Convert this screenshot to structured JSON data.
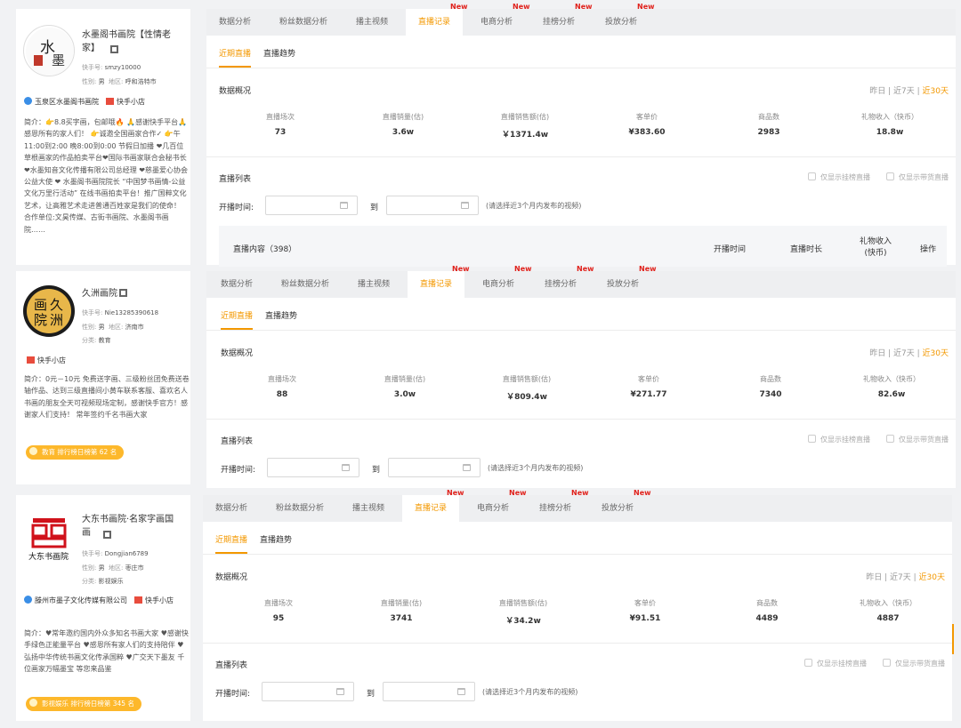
{
  "colors": {
    "accent": "#f39800",
    "new_badge": "#e0211b",
    "rank_badge": "#fdb82b"
  },
  "panels": [
    {
      "profile": {
        "name": "水墨阁书画院【性情老家】",
        "id_label": "快手号:",
        "id_value": "smzy10000",
        "gender_label": "性别:",
        "gender": "男",
        "region_label": "地区:",
        "region": "呼和浩特市",
        "category_label": "",
        "category": "",
        "verify": "玉泉区水墨阁书画院",
        "shop": "快手小店",
        "bio": "简介：👉8.8买字画，包邮哦🔥 🙏感谢快手平台🙏感恩所有的家人们！ 👉诚邀全国画家合作✓ 👉午11:00到2:00 晚8:00到0:00 节假日加播 ❤几百位草根画家的作品拍卖平台❤国际书画家联合会秘书长 ❤水墨知音文化传播有限公司总经理 ❤慈墨爱心协会公益大使 ❤ 水墨阁书画院院长 “中国梦书画情-公益文化万里行活动” 在线书画拍卖平台！推广国粹文化艺术，让高雅艺术走进普通百姓家是我们的使命！ 合作单位:文昊传媒、古街书画院、水墨阁书画院……",
        "rank": ""
      },
      "tabs": [
        "数据分析",
        "粉丝数据分析",
        "播主视频",
        "直播记录",
        "电商分析",
        "挂榜分析",
        "投放分析"
      ],
      "new_label": "New",
      "subtabs": [
        "近期直播",
        "直播趋势"
      ],
      "overview_title": "数据概况",
      "range": {
        "a": "昨日",
        "sep": "|",
        "b": "近7天",
        "c": "近30天"
      },
      "stats": [
        {
          "label": "直播场次",
          "value": "73"
        },
        {
          "label": "直播销量(估)",
          "value": "3.6w"
        },
        {
          "label": "直播销售额(估)",
          "value": "￥1371.4w"
        },
        {
          "label": "客单价",
          "value": "¥383.60"
        },
        {
          "label": "商品数",
          "value": "2983"
        },
        {
          "label": "礼物收入（快币）",
          "value": "18.8w"
        }
      ],
      "list_title": "直播列表",
      "check_a": "仅显示挂榜直播",
      "check_b": "仅显示带货直播",
      "time_label": "开播时间:",
      "to": "到",
      "hint": "(请选择近3个月内发布的视频)",
      "table": {
        "col1": "直播内容（398）",
        "col2": "开播时间",
        "col3": "直播时长",
        "col4a": "礼物收入",
        "col4b": "(快币)",
        "col5": "操作"
      }
    },
    {
      "profile": {
        "name": "久洲画院",
        "id_label": "快手号:",
        "id_value": "Nie13285390618",
        "gender_label": "性别:",
        "gender": "男",
        "region_label": "地区:",
        "region": "济南市",
        "category_label": "分类:",
        "category": "教育",
        "verify": "",
        "shop": "快手小店",
        "bio": "简介：0元－10元 免费送字画、三级粉丝团免费送卷轴作品、达到三级直播间小黄车联系客服、喜欢名人书画的朋友全天可视频现场定制，感谢快手官方！感谢家人们支持！ 常年签约千名书画大家",
        "rank": "教育 排行榜日榜第 62 名"
      },
      "tabs": [
        "数据分析",
        "粉丝数据分析",
        "播主视频",
        "直播记录",
        "电商分析",
        "挂榜分析",
        "投放分析"
      ],
      "new_label": "New",
      "subtabs": [
        "近期直播",
        "直播趋势"
      ],
      "overview_title": "数据概况",
      "range": {
        "a": "昨日",
        "sep": "|",
        "b": "近7天",
        "c": "近30天"
      },
      "stats": [
        {
          "label": "直播场次",
          "value": "88"
        },
        {
          "label": "直播销量(估)",
          "value": "3.0w"
        },
        {
          "label": "直播销售额(估)",
          "value": "￥809.4w"
        },
        {
          "label": "客单价",
          "value": "¥271.77"
        },
        {
          "label": "商品数",
          "value": "7340"
        },
        {
          "label": "礼物收入（快币）",
          "value": "82.6w"
        }
      ],
      "list_title": "直播列表",
      "check_a": "仅显示挂榜直播",
      "check_b": "仅显示带货直播",
      "time_label": "开播时间:",
      "to": "到",
      "hint": "(请选择近3个月内发布的视频)"
    },
    {
      "profile": {
        "name": "大东书画院·名家字画国画",
        "id_label": "快手号:",
        "id_value": "Dongjian6789",
        "gender_label": "性别:",
        "gender": "男",
        "region_label": "地区:",
        "region": "枣庄市",
        "category_label": "分类:",
        "category": "影视娱乐",
        "verify": "滕州市墨子文化传媒有限公司",
        "shop": "快手小店",
        "bio": "简介：♥常年邀约国内外众多知名书画大家 ♥感谢快手绿色正能量平台 ♥感恩所有家人们的支持陪伴 ♥弘扬中华传统书画文化传承国粹 ♥广交天下墨友 千位画家万幅墨宝 等您来品鉴",
        "rank": "影视娱乐 排行榜日榜第 345 名"
      },
      "tabs": [
        "数据分析",
        "粉丝数据分析",
        "播主视频",
        "直播记录",
        "电商分析",
        "挂榜分析",
        "投放分析"
      ],
      "new_label": "New",
      "subtabs": [
        "近期直播",
        "直播趋势"
      ],
      "overview_title": "数据概况",
      "range": {
        "a": "昨日",
        "sep": "|",
        "b": "近7天",
        "c": "近30天"
      },
      "stats": [
        {
          "label": "直播场次",
          "value": "95"
        },
        {
          "label": "直播销量(估)",
          "value": "3741"
        },
        {
          "label": "直播销售额(估)",
          "value": "￥34.2w"
        },
        {
          "label": "客单价",
          "value": "¥91.51"
        },
        {
          "label": "商品数",
          "value": "4489"
        },
        {
          "label": "礼物收入（快币）",
          "value": "4887"
        }
      ],
      "list_title": "直播列表",
      "check_a": "仅显示挂榜直播",
      "check_b": "仅显示带货直播",
      "time_label": "开播时间:",
      "to": "到",
      "hint": "(请选择近3个月内发布的视频)"
    }
  ]
}
